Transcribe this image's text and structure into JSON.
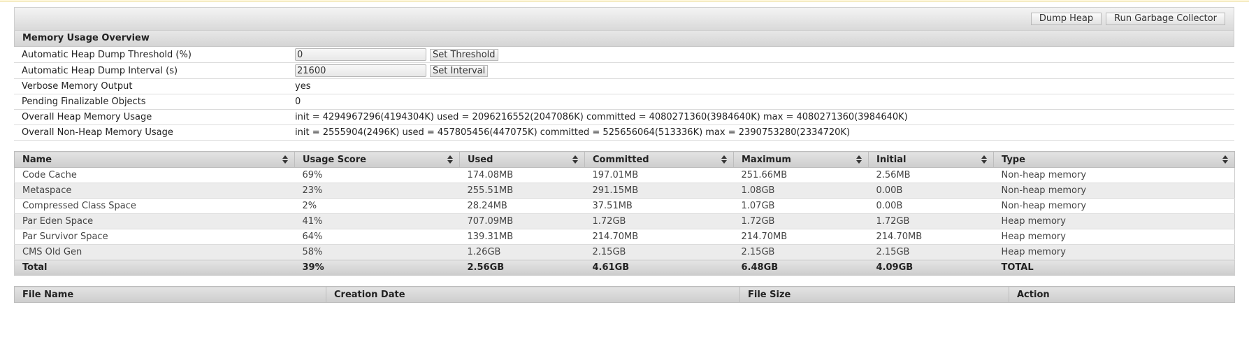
{
  "toolbar": {
    "dump_heap": "Dump Heap",
    "run_gc": "Run Garbage Collector"
  },
  "overview": {
    "title": "Memory Usage Overview",
    "threshold": {
      "label": "Automatic Heap Dump Threshold (%)",
      "value": "0",
      "button": "Set Threshold"
    },
    "interval": {
      "label": "Automatic Heap Dump Interval (s)",
      "value": "21600",
      "button": "Set Interval"
    },
    "verbose": {
      "label": "Verbose Memory Output",
      "value": "yes"
    },
    "pending": {
      "label": "Pending Finalizable Objects",
      "value": "0"
    },
    "heap": {
      "label": "Overall Heap Memory Usage",
      "value": "init = 4294967296(4194304K) used = 2096216552(2047086K) committed = 4080271360(3984640K) max = 4080271360(3984640K)"
    },
    "nonheap": {
      "label": "Overall Non-Heap Memory Usage",
      "value": "init = 2555904(2496K) used = 457805456(447075K) committed = 525656064(513336K) max = 2390753280(2334720K)"
    }
  },
  "memory_table": {
    "headers": [
      "Name",
      "Usage Score",
      "Used",
      "Committed",
      "Maximum",
      "Initial",
      "Type"
    ],
    "rows": [
      [
        "Code Cache",
        "69%",
        "174.08MB",
        "197.01MB",
        "251.66MB",
        "2.56MB",
        "Non-heap memory"
      ],
      [
        "Metaspace",
        "23%",
        "255.51MB",
        "291.15MB",
        "1.08GB",
        "0.00B",
        "Non-heap memory"
      ],
      [
        "Compressed Class Space",
        "2%",
        "28.24MB",
        "37.51MB",
        "1.07GB",
        "0.00B",
        "Non-heap memory"
      ],
      [
        "Par Eden Space",
        "41%",
        "707.09MB",
        "1.72GB",
        "1.72GB",
        "1.72GB",
        "Heap memory"
      ],
      [
        "Par Survivor Space",
        "64%",
        "139.31MB",
        "214.70MB",
        "214.70MB",
        "214.70MB",
        "Heap memory"
      ],
      [
        "CMS Old Gen",
        "58%",
        "1.26GB",
        "2.15GB",
        "2.15GB",
        "2.15GB",
        "Heap memory"
      ]
    ],
    "total": [
      "Total",
      "39%",
      "2.56GB",
      "4.61GB",
      "6.48GB",
      "4.09GB",
      "TOTAL"
    ]
  },
  "files_table": {
    "headers": [
      "File Name",
      "Creation Date",
      "File Size",
      "Action"
    ]
  }
}
